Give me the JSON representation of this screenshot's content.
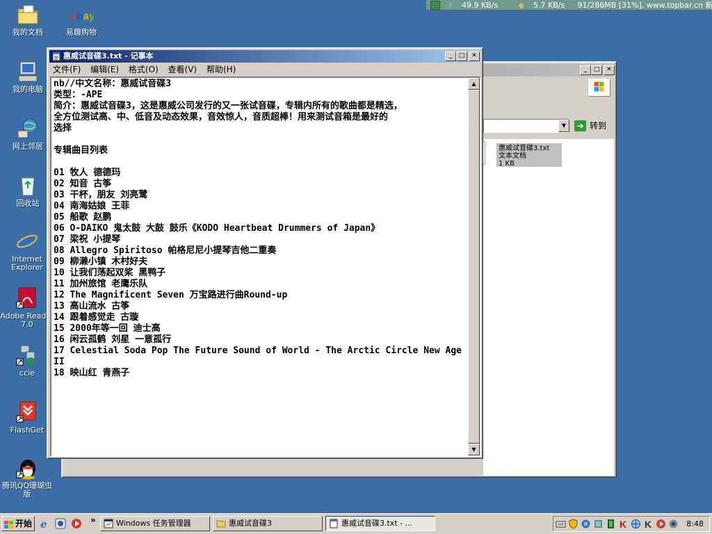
{
  "topbar": {
    "down_speed": "49.9 KB/s",
    "up_speed": "5.7 KB/s",
    "memory": "91/286MB [31%], www.topbar.cn 新:"
  },
  "desktop_icons": [
    {
      "label": "我的文档",
      "icon": "my-documents-icon"
    },
    {
      "label": "易趣购物",
      "icon": "ebay-icon"
    },
    {
      "label": "我的电脑",
      "icon": "my-computer-icon"
    },
    {
      "label": "网上邻居",
      "icon": "network-icon"
    },
    {
      "label": "回收站",
      "icon": "recycle-bin-icon"
    },
    {
      "label": "Internet Explorer",
      "icon": "ie-icon"
    },
    {
      "label": "Adobe Reader 7.0",
      "icon": "adobe-reader-icon"
    },
    {
      "label": "ccie",
      "icon": "ccie-shortcut-icon"
    },
    {
      "label": "FlashGet",
      "icon": "flashget-icon"
    },
    {
      "label": "腾讯QQ珊瑚虫版",
      "icon": "qq-icon"
    }
  ],
  "explorer": {
    "go_label": "转到",
    "file": {
      "name": "惠威试音碟3.txt",
      "type": "文本文档",
      "size": "1 KB"
    }
  },
  "notepad": {
    "title": "惠威试音碟3.txt - 记事本",
    "menus": [
      "文件(F)",
      "编辑(E)",
      "格式(O)",
      "查看(V)",
      "帮助(H)"
    ],
    "lines": [
      "nb//中文名称：惠威试音碟3",
      "类型：-APE",
      "简介：惠威试音碟3，这是惠威公司发行的又一张试音碟，专辑内所有的歌曲都是精选，",
      "全方位测试高、中、低音及动态效果，音效惊人，音质超棒！用来测试音箱是最好的",
      "选择",
      "",
      "专辑曲目列表",
      "",
      "01 牧人 德德玛",
      "02 知音 古筝",
      "03 干杯，朋友 刘亮鹭",
      "04 南海姑娘 王菲",
      "05 船歌 赵鹏",
      "06 O-DAIKO 鬼太鼓 大鼓 鼓乐《KODO Heartbeat Drummers of Japan》",
      "07 梁祝 小提琴",
      "08 Allegro Spiritoso 帕格尼尼小提琴吉他二重奏",
      "09 柳濑小镇 木村好夫",
      "10 让我们荡起双桨 黑鸭子",
      "11 加州旅馆 老鹰乐队",
      "12 The Magnificent Seven 万宝路进行曲Round-up",
      "13 高山流水 古筝",
      "14 跟着感觉走 古璇",
      "15 2000年等一回 迪士高",
      "16 闲云孤鹤 刘星 一意孤行",
      "17 Celestial Soda Pop The Future Sound of World - The Arctic Circle New Age",
      "II",
      "18 映山红 青燕子"
    ]
  },
  "taskbar": {
    "start_label": "开始",
    "tasks": [
      {
        "label": "Windows 任务管理器",
        "icon": "task-manager-icon",
        "pressed": false
      },
      {
        "label": "惠威试音碟3",
        "icon": "folder-icon",
        "pressed": false
      },
      {
        "label": "惠威试音碟3.txt - ...",
        "icon": "notepad-icon",
        "pressed": true
      }
    ],
    "clock": "8:48"
  },
  "colors": {
    "desktop": "#3a6ea5",
    "active_title": "#0a246a",
    "window_face": "#d4d0c8"
  }
}
